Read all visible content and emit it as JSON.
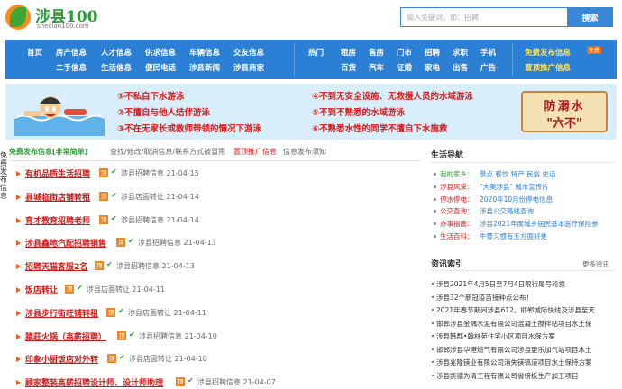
{
  "header": {
    "logo_title": "涉县100",
    "logo_url": "shexian100.com",
    "search_placeholder": "输入关键词，如：招聘",
    "search_button": "搜索"
  },
  "nav": {
    "row1_left": [
      "首页",
      "房产信息",
      "人才信息",
      "供求信息",
      "车辆信息",
      "交友信息"
    ],
    "row2_left": [
      "二手信息",
      "生活信息",
      "便民电话",
      "涉县新闻",
      "涉县商家"
    ],
    "row1_mid": [
      "热门",
      "租房",
      "售房",
      "门市",
      "招聘",
      "求职",
      "手机"
    ],
    "row2_mid": [
      "百货",
      "汽车",
      "征婚",
      "家电",
      "出售",
      "广告"
    ],
    "row1_right": "免费发布信息",
    "row1_badge": "免费",
    "row2_right": "置顶推广信息"
  },
  "banner": {
    "lines_left": [
      "①不私自下水游泳",
      "②不擅自与他人结伴游泳",
      "③不在无家长或教师带领的情况下游泳"
    ],
    "lines_right": [
      "④不到无安全设施、无救援人员的水域游泳",
      "⑤不到不熟悉的水域游泳",
      "⑥不熟悉水性的同学不擅自下水施救"
    ],
    "sign_line1": "防溺水",
    "sign_line2": "\"六不\""
  },
  "side_text": "免费发布信息",
  "tabs": {
    "main": "免费发布信息[非常简单]",
    "links": "查找/修改/取消信息/联系方式被冒用",
    "red": "置顶推广信息",
    "tail": "信息发布须知"
  },
  "listings": [
    {
      "title": "有机品质生活招聘",
      "tag": "顶",
      "meta": "涉县招聘信息 21-04-15"
    },
    {
      "title": "县城临街店铺转租",
      "tag": "顶",
      "meta": "涉县店面转让 21-04-14"
    },
    {
      "title": "育才教育招聘老师",
      "tag": "顶",
      "meta": "涉县招聘信息 21-04-14"
    },
    {
      "title": "涉县鑫地汽配招聘销售",
      "tag": "顶",
      "meta": "涉县招聘信息 21-04-13"
    },
    {
      "title": "招聘天猫客服2名",
      "tag": "顶",
      "meta": "涉县招聘信息 21-04-13"
    },
    {
      "title": "饭店转让",
      "tag": "顶",
      "meta": "涉县店面转让 21-04-11"
    },
    {
      "title": "涉县步行街旺铺转租",
      "tag": "顶",
      "meta": "涉县店面转让 21-04-11"
    },
    {
      "title": "猿莊火锅（高薪招聘）",
      "tag": "顶",
      "meta": "涉县招聘信息 21-04-10"
    },
    {
      "title": "印象小厨饭店对外转",
      "tag": "顶",
      "meta": "涉县店面转让 21-04-10"
    },
    {
      "title": "顾家整装高薪招聘设计师、设计师助理",
      "tag": "顶",
      "meta": "涉县招聘信息 21-04-07"
    }
  ],
  "life_guide": {
    "title": "生活导航",
    "items": [
      {
        "key": "我的家乡：",
        "value": "景点 餐饮 特产 民俗 史话"
      },
      {
        "key": "涉县风采：",
        "value": "\"大美涉县\" 城市宣传片"
      },
      {
        "key": "停水停电：",
        "value": "2020年10月份停电信息"
      },
      {
        "key": "公交查询：",
        "value": "涉县公交路线查询"
      },
      {
        "key": "办事指南：",
        "value": "涉县2021年度城乡居民基本医疗保险参"
      },
      {
        "key": "生活百科：",
        "value": "牛蒡习惯有五方面好处"
      }
    ]
  },
  "news": {
    "title": "资讯索引",
    "more": "更多资讯",
    "items": [
      "涉县2021年4月5日至7月4日限行尾号轮换",
      "涉县32个新冠疫苗接种点公布！",
      "2021年春节期间涉县612。邯郸城际快线及涉县至天",
      "邯郸涉县金隅水泥有限公司混凝土搅拌站项目水土保",
      "涉县韩郡•翰林苑住宅小区项目水保方案",
      "邯郸涉县华港燃气有限公司涉县更乐加气站项目水土",
      "涉县兆隆镁业有限公司消失镁镐道项目水土保持方案",
      "涉县凯德为清工程有限公司省榜板生产加工项目"
    ]
  },
  "colors": {
    "brand_green": "#2f9a38",
    "nav_blue": "#2b7fd4",
    "title_red": "#c91b1b",
    "tag_orange": "#e88a2a"
  }
}
